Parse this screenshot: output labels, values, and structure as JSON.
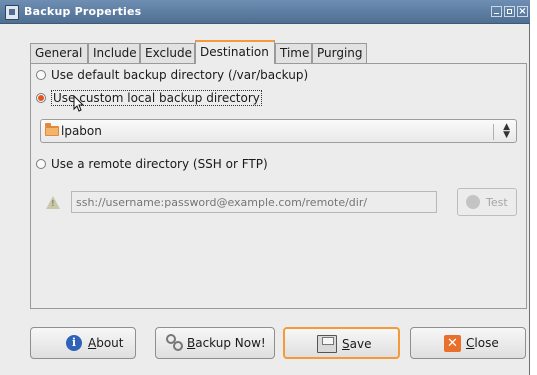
{
  "window": {
    "title": "Backup Properties"
  },
  "tabs": [
    {
      "label": "General"
    },
    {
      "label": "Include"
    },
    {
      "label": "Exclude"
    },
    {
      "label": "Destination",
      "selected": true
    },
    {
      "label": "Time"
    },
    {
      "label": "Purging"
    }
  ],
  "destination": {
    "option_default": "Use default backup directory (/var/backup)",
    "option_custom": "Use custom local backup directory",
    "option_remote": "Use a remote directory (SSH or FTP)",
    "selected_option": "option_custom",
    "folder_value": "lpabon",
    "remote_placeholder": "ssh://username:password@example.com/remote/dir/",
    "test_label": "Test"
  },
  "buttons": {
    "about": "About",
    "backup_now": "Backup Now!",
    "save": "Save",
    "close": "Close"
  },
  "colors": {
    "titlebar": "#5a7ba0",
    "accent": "#f39a3a",
    "radio_selected": "#e4561a"
  }
}
